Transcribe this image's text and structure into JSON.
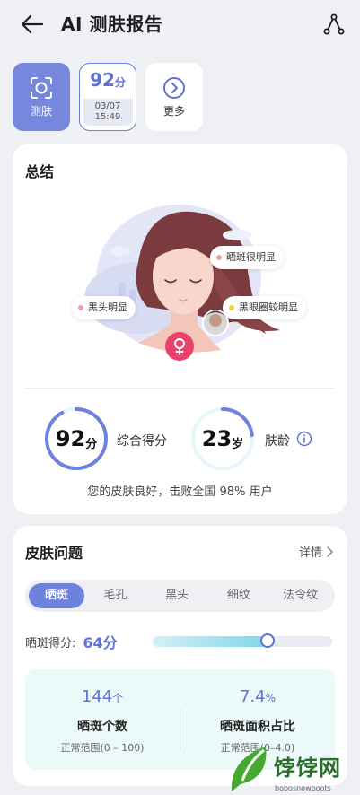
{
  "header": {
    "title": "AI 测肤报告"
  },
  "tiles": {
    "scan_label": "测肤",
    "score_value": "92",
    "score_unit": "分",
    "score_date": "03/07",
    "score_time": "15:49",
    "more_label": "更多"
  },
  "summary": {
    "title": "总结",
    "bubble_spots": "晒斑很明显",
    "bubble_blackheads": "黑头明显",
    "bubble_darkcircles": "黑眼圈较明显",
    "overall_score": "92",
    "overall_unit": "分",
    "overall_label": "综合得分",
    "overall_fraction": 0.92,
    "skin_age": "23",
    "skin_age_unit": "岁",
    "skin_age_label": "肤龄",
    "skin_age_fraction": 0.23,
    "line": "您的皮肤良好，击败全国 98% 用户"
  },
  "issues": {
    "title": "皮肤问题",
    "detail_label": "详情",
    "chips": [
      "晒斑",
      "毛孔",
      "黑头",
      "细纹",
      "法令纹"
    ],
    "active_chip": 0,
    "score_label": "晒斑得分:",
    "score_value": "64分",
    "score_fraction": 0.64,
    "stat1_value": "144",
    "stat1_unit": "个",
    "stat1_name": "晒斑个数",
    "stat1_range": "正常范围(0 – 100)",
    "stat2_value": "7.4",
    "stat2_unit": "%",
    "stat2_name": "晒斑面积占比",
    "stat2_range": "正常范围(0–4.0)"
  },
  "watermark": {
    "text": "饽饽网",
    "sub": "bobosnowboots"
  },
  "colors": {
    "accent": "#6e81dd",
    "bubble_dot_pink": "#f0a0a8",
    "bubble_dot_yellow": "#f2d13c",
    "gender": "#e8436a"
  }
}
